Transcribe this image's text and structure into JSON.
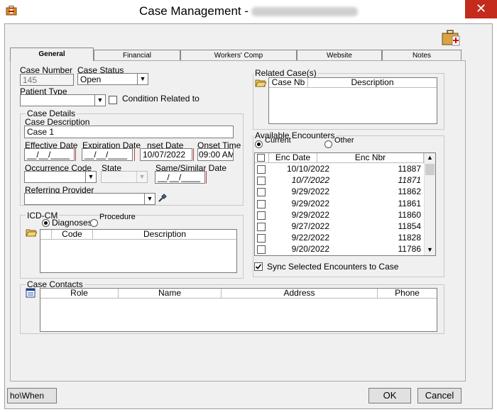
{
  "window": {
    "title": "Case Management -",
    "close_glyph": "✕"
  },
  "tabs": [
    "General",
    "Financial",
    "Workers' Comp",
    "Website",
    "Notes"
  ],
  "case_number": {
    "label": "Case Number",
    "value": "145"
  },
  "case_status": {
    "label": "Case Status",
    "value": "Open"
  },
  "patient_type": {
    "label": "Patient Type",
    "value": ""
  },
  "condition_related": {
    "label": "Condition Related to",
    "checked": false
  },
  "case_details": {
    "legend": "Case Details",
    "description_label": "Case Description",
    "description_value": "Case 1",
    "effective_label": "Effective Date",
    "effective_value": "__/__/____",
    "expiration_label": "Expiration Date",
    "expiration_value": "__/__/____",
    "onset_date_label": "nset Date",
    "onset_date_value": "10/07/2022",
    "onset_time_label": "Onset Time",
    "onset_time_value": "09:00 AM",
    "occurrence_label": "Occurrence Code",
    "state_label": "State",
    "same_similar_label": "Same/Similar Date",
    "same_similar_value": "__/__/____",
    "referring_label": "Referring Provider"
  },
  "icd": {
    "legend": "ICD-CM",
    "radio_diagnoses": "Diagnoses",
    "radio_procedure": "Procedure",
    "col_code": "Code",
    "col_description": "Description"
  },
  "related": {
    "legend": "Related Case(s)",
    "col_case_nb": "Case Nb",
    "col_description": "Description"
  },
  "encounters": {
    "legend": "Available Encounters",
    "radio_current": "Current",
    "radio_other": "Other",
    "col_date": "Enc Date",
    "col_nbr": "Enc Nbr",
    "rows": [
      {
        "date": "10/10/2022",
        "nbr": "11887",
        "italic": false
      },
      {
        "date": "10/7/2022",
        "nbr": "11871",
        "italic": true
      },
      {
        "date": "9/29/2022",
        "nbr": "11862",
        "italic": false
      },
      {
        "date": "9/29/2022",
        "nbr": "11861",
        "italic": false
      },
      {
        "date": "9/29/2022",
        "nbr": "11860",
        "italic": false
      },
      {
        "date": "9/27/2022",
        "nbr": "11854",
        "italic": false
      },
      {
        "date": "9/22/2022",
        "nbr": "11828",
        "italic": false
      },
      {
        "date": "9/20/2022",
        "nbr": "11786",
        "italic": false
      }
    ],
    "sync_label": "Sync Selected Encounters to Case",
    "sync_checked": true
  },
  "contacts": {
    "legend": "Case Contacts",
    "col_role": "Role",
    "col_name": "Name",
    "col_address": "Address",
    "col_phone": "Phone"
  },
  "buttons": {
    "who_when": "ho\\When",
    "ok": "OK",
    "cancel": "Cancel"
  },
  "colors": {
    "close": "#c42b1c",
    "frame": "#f0f0f0"
  },
  "icons": [
    "app-icon",
    "briefcase-icon",
    "folder-open-icon",
    "flashlight-icon",
    "list-icon"
  ]
}
